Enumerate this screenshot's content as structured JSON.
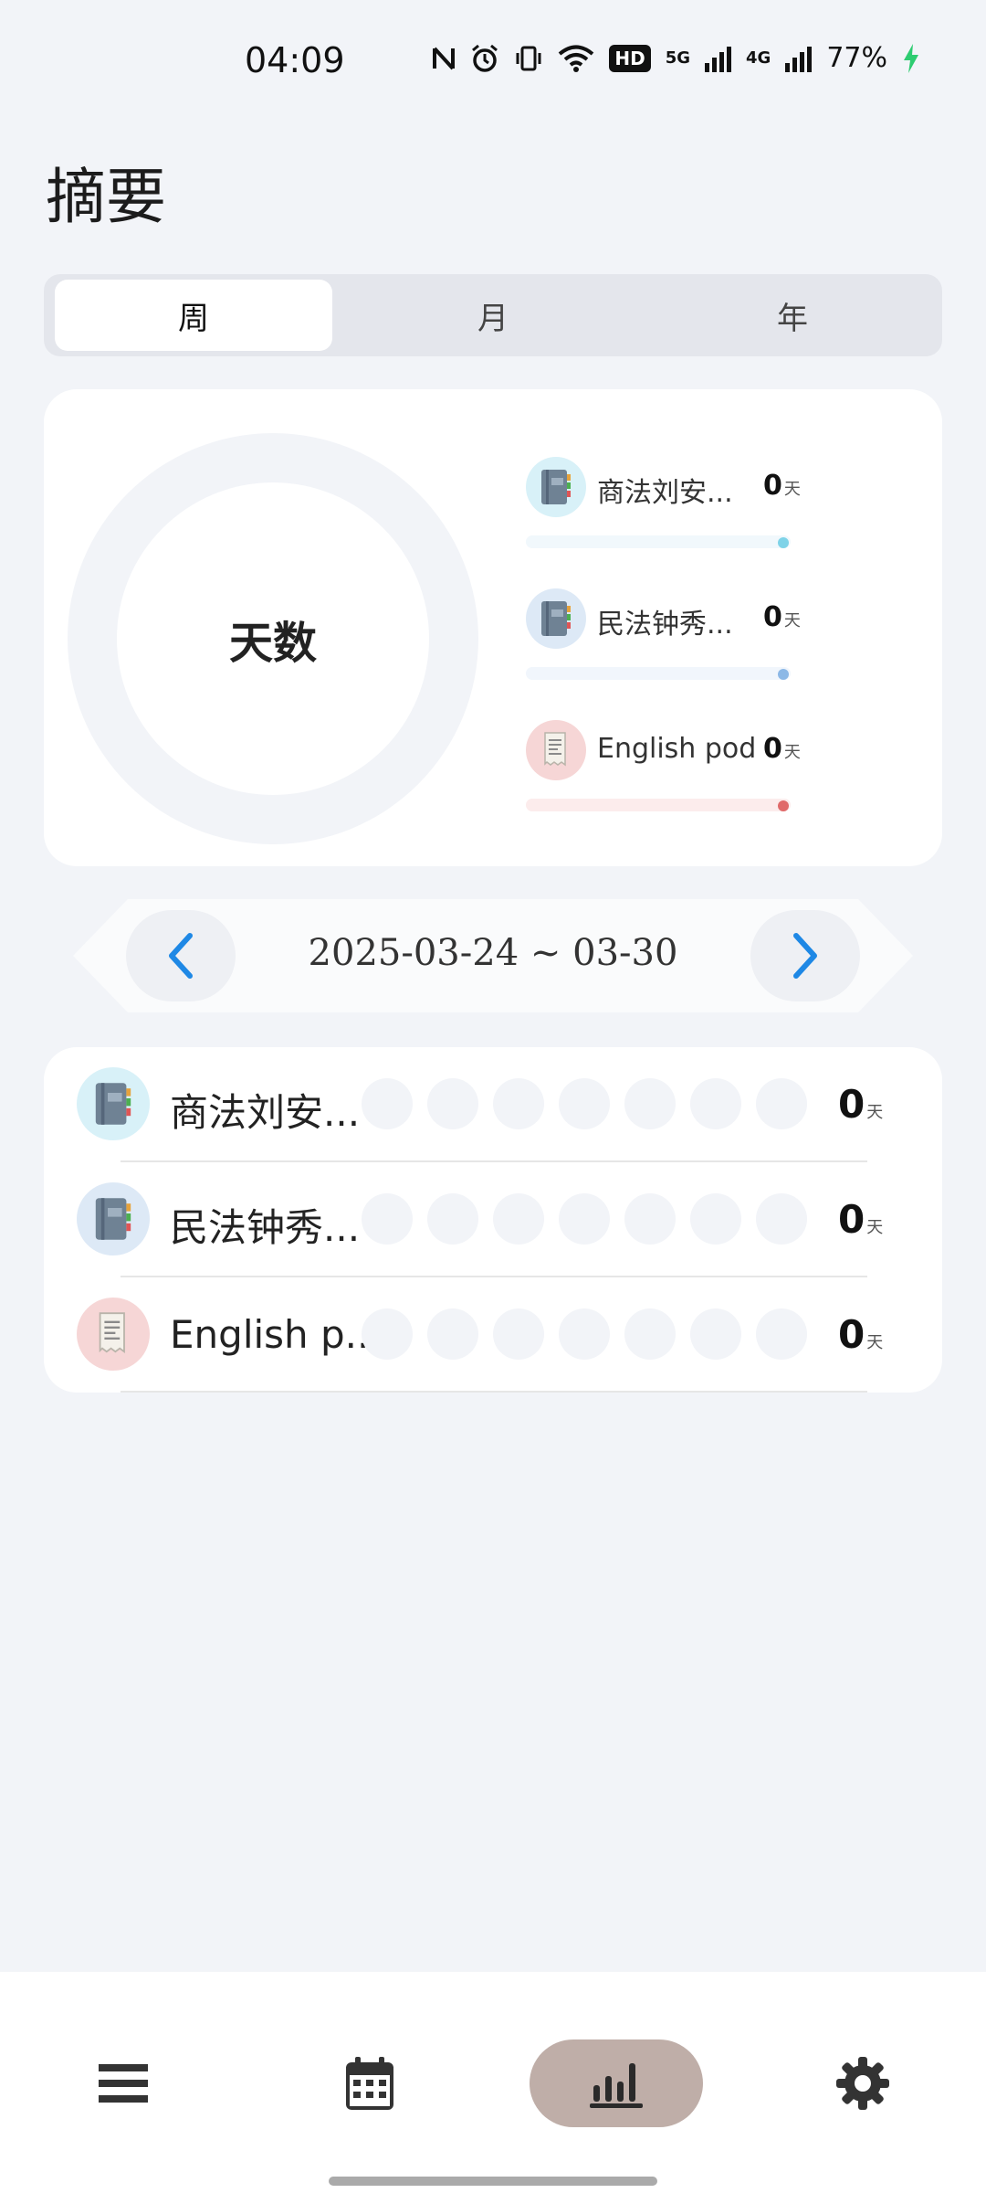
{
  "status": {
    "time": "04:09",
    "hd": "HD",
    "net1": "5G",
    "net2": "4G",
    "battery": "77%"
  },
  "page_title": "摘要",
  "tabs": [
    {
      "label": "周",
      "active": true
    },
    {
      "label": "月",
      "active": false
    },
    {
      "label": "年",
      "active": false
    }
  ],
  "summary": {
    "ring_label": "天数",
    "unit": "天",
    "items": [
      {
        "name": "商法刘安...",
        "value": "0",
        "icon": "notebook-icon",
        "bar_color": "#f1f8fc",
        "dot_color": "#7fd3e8",
        "icon_bg": "#d8f1f8"
      },
      {
        "name": "民法钟秀...",
        "value": "0",
        "icon": "notebook-icon",
        "bar_color": "#f1f6fc",
        "dot_color": "#8cb8e6",
        "icon_bg": "#dde9f6"
      },
      {
        "name": "English pod",
        "value": "0",
        "icon": "receipt-icon",
        "bar_color": "#fcecec",
        "dot_color": "#e06a6a",
        "icon_bg": "#f6d6d6"
      }
    ]
  },
  "week": {
    "range": "2025-03-24 ~ 03-30",
    "prev_icon": "chevron-left-icon",
    "next_icon": "chevron-right-icon"
  },
  "detail": {
    "unit": "天",
    "rows": [
      {
        "name": "商法刘安...",
        "value": "0",
        "icon": "notebook-icon"
      },
      {
        "name": "民法钟秀...",
        "value": "0",
        "icon": "notebook-icon"
      },
      {
        "name": "English p...",
        "value": "0",
        "icon": "receipt-icon"
      }
    ]
  },
  "bottom_nav": [
    {
      "icon": "list-icon",
      "active": false
    },
    {
      "icon": "calendar-icon",
      "active": false
    },
    {
      "icon": "bar-chart-icon",
      "active": true
    },
    {
      "icon": "gear-icon",
      "active": false
    }
  ],
  "colors": {
    "accent": "#1e88e5",
    "background": "#f2f4f8",
    "nav_active": "#bfaea8"
  }
}
